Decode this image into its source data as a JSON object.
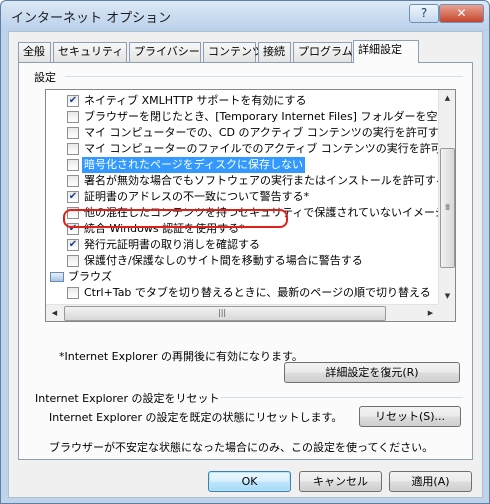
{
  "window": {
    "title": "インターネット オプション",
    "help_glyph": "?",
    "close_glyph": "✕"
  },
  "tabs": [
    {
      "label": "全般"
    },
    {
      "label": "セキュリティ"
    },
    {
      "label": "プライバシー"
    },
    {
      "label": "コンテンツ"
    },
    {
      "label": "接続"
    },
    {
      "label": "プログラム"
    },
    {
      "label": "詳細設定",
      "active": true
    }
  ],
  "settings": {
    "group_label": "設定",
    "items": [
      {
        "text": "ネイティブ XMLHTTP サポートを有効にする",
        "checked": true
      },
      {
        "text": "ブラウザーを閉じたとき、[Temporary Internet Files] フォルダーを空にす",
        "checked": false
      },
      {
        "text": "マイ コンピューターでの、CD のアクティブ コンテンツの実行を許可する*",
        "checked": false
      },
      {
        "text": "マイ コンピューターのファイルでのアクティブ コンテンツの実行を許可する*",
        "checked": false
      },
      {
        "text": "暗号化されたページをディスクに保存しない",
        "checked": false,
        "selected": true
      },
      {
        "text": "署名が無効な場合でもソフトウェアの実行またはインストールを許可する",
        "checked": false
      },
      {
        "text": "証明書のアドレスの不一致について警告する*",
        "checked": true
      },
      {
        "text": "他の混在したコンテンツを持つセキュリティで保護されていないイメージをブ",
        "checked": false
      },
      {
        "text": "統合 Windows 認証を使用する*",
        "checked": true
      },
      {
        "text": "発行元証明書の取り消しを確認する",
        "checked": true
      },
      {
        "text": "保護付き/保護なしのサイト間を移動する場合に警告する",
        "checked": false
      },
      {
        "text": "ブラウズ",
        "category": true
      },
      {
        "text": "Ctrl+Tab でタブを切り替えるときに、最新のページの順で切り替える",
        "checked": false
      }
    ],
    "check_glyph": "✔",
    "restart_note": "*Internet Explorer の再開後に有効になります。",
    "restore_button": "詳細設定を復元(R)"
  },
  "reset": {
    "label": "Internet Explorer の設定をリセット",
    "description": "Internet Explorer の設定を既定の状態にリセットします。",
    "button": "リセット(S)...",
    "warning": "ブラウザーが不安定な状態になった場合にのみ、この設定を使ってください。"
  },
  "buttons": {
    "ok": "OK",
    "cancel": "キャンセル",
    "apply": "適用(A)"
  },
  "colors": {
    "selection": "#3399ff",
    "highlight_outline": "#e0201a"
  }
}
